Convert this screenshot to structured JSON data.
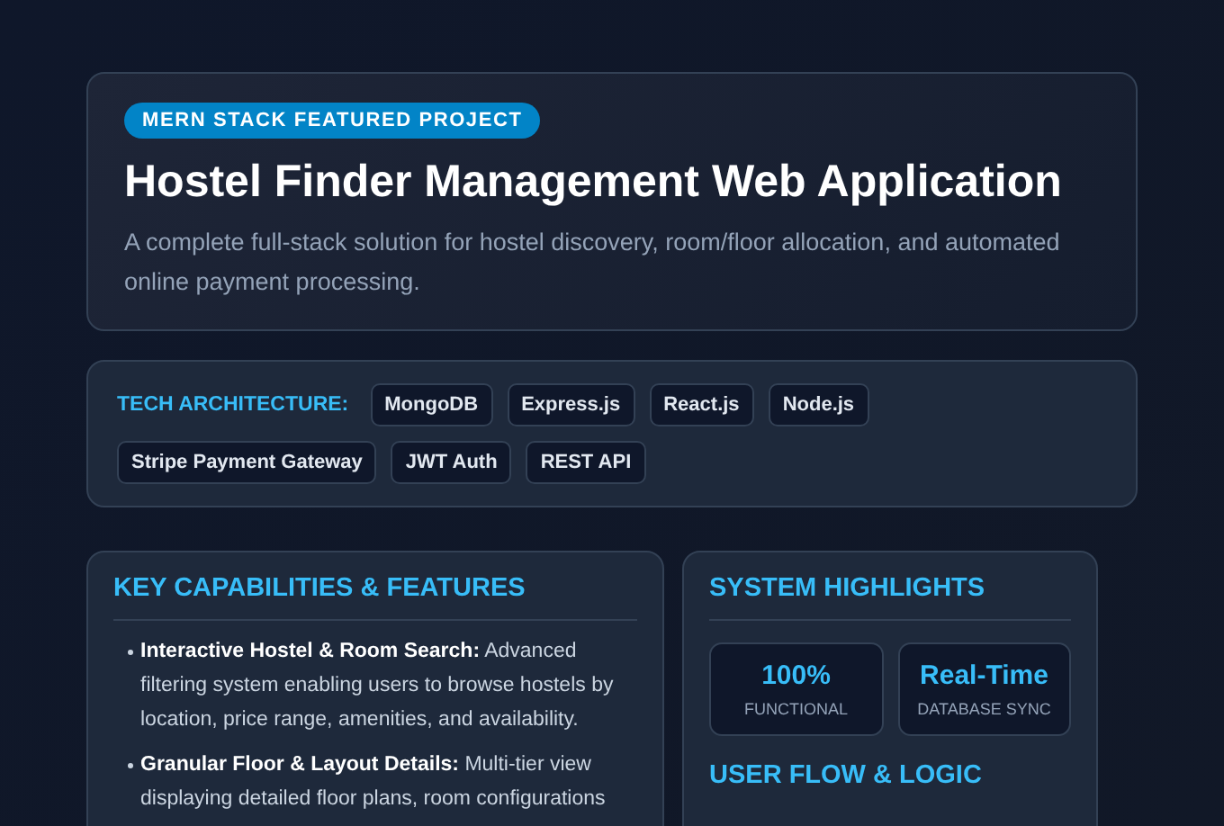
{
  "hero": {
    "badge": "MERN STACK FEATURED PROJECT",
    "title": "Hostel Finder Management Web Application",
    "description": "A complete full-stack solution for hostel discovery, room/floor allocation, and automated online payment processing."
  },
  "tech": {
    "label": "TECH ARCHITECTURE:",
    "tags": [
      "MongoDB",
      "Express.js",
      "React.js",
      "Node.js",
      "Stripe Payment Gateway",
      "JWT Auth",
      "REST API"
    ]
  },
  "features": {
    "heading": "KEY CAPABILITIES & FEATURES",
    "items": [
      {
        "text": "**Interactive Hostel & Room Search:** Advanced filtering system enabling users to browse hostels by location, price range, amenities, and availability."
      },
      {
        "text": "**Granular Floor & Layout Details:** Multi-tier view displaying detailed floor plans, room configurations"
      }
    ]
  },
  "highlights": {
    "heading": "SYSTEM HIGHLIGHTS",
    "stats": [
      {
        "value": "100%",
        "label": "FUNCTIONAL"
      },
      {
        "value": "Real-Time",
        "label": "DATABASE SYNC"
      }
    ],
    "next_heading": "USER FLOW & LOGIC"
  }
}
